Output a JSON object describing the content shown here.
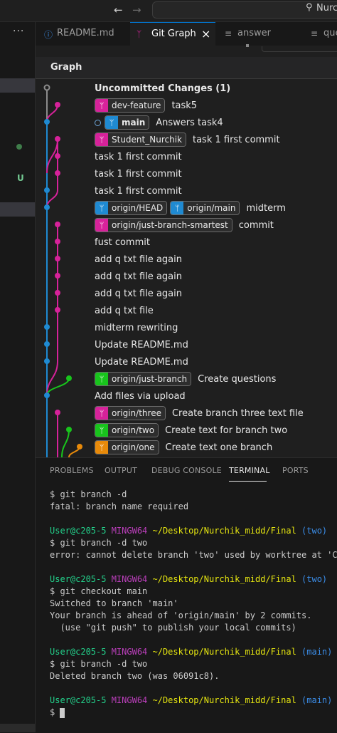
{
  "titlebar": {
    "back_icon": "arrow-left-icon",
    "forward_icon": "arrow-right-icon",
    "search_text": "Nurchik",
    "search_icon": "search-icon"
  },
  "sidebar": {
    "more_icon": "ellipsis-icon",
    "u_badge": "U"
  },
  "tabs": [
    {
      "label": "README.md",
      "icon": "info-icon",
      "active": false
    },
    {
      "label": "Git Graph",
      "icon": "git-graph-icon",
      "active": true,
      "close": "×"
    },
    {
      "label": "answer",
      "icon": "lines-icon",
      "active": false
    },
    {
      "label": "que",
      "icon": "lines-icon",
      "active": false
    }
  ],
  "graph": {
    "header": "Graph",
    "colors": {
      "blue": "#1f8ad2",
      "pink": "#d6229a",
      "green": "#18c41c",
      "orange": "#e88a0a",
      "grey": "#8c8c8c"
    },
    "commits": [
      {
        "refs": [],
        "message": "Uncommitted Changes (1)",
        "bold": true
      },
      {
        "refs": [
          {
            "name": "dev-feature",
            "color": "#d6229a"
          }
        ],
        "message": "task5"
      },
      {
        "head": true,
        "refs": [
          {
            "name": "main",
            "color": "#1f8ad2",
            "head": true
          }
        ],
        "message": "Answers task4"
      },
      {
        "refs": [
          {
            "name": "Student_Nurchik",
            "color": "#d6229a"
          }
        ],
        "message": "task 1 first commit"
      },
      {
        "refs": [],
        "message": "task 1 first commit"
      },
      {
        "refs": [],
        "message": "task 1 first commit"
      },
      {
        "refs": [],
        "message": "task 1 first commit"
      },
      {
        "refs": [
          {
            "name": "origin/HEAD",
            "color": "#1f8ad2"
          },
          {
            "name": "origin/main",
            "color": "#1f8ad2"
          }
        ],
        "message": "midterm"
      },
      {
        "refs": [
          {
            "name": "origin/just-branch-smartest",
            "color": "#d6229a"
          }
        ],
        "message": "commit"
      },
      {
        "refs": [],
        "message": "fust commit"
      },
      {
        "refs": [],
        "message": "add q txt file again"
      },
      {
        "refs": [],
        "message": "add q txt file again"
      },
      {
        "refs": [],
        "message": "add q txt file again"
      },
      {
        "refs": [],
        "message": "add q txt file"
      },
      {
        "refs": [],
        "message": "midterm rewriting"
      },
      {
        "refs": [],
        "message": "Update README.md"
      },
      {
        "refs": [],
        "message": "Update README.md"
      },
      {
        "refs": [
          {
            "name": "origin/just-branch",
            "color": "#18c41c"
          }
        ],
        "message": "Create questions"
      },
      {
        "refs": [],
        "message": "Add files via upload"
      },
      {
        "refs": [
          {
            "name": "origin/three",
            "color": "#d6229a"
          }
        ],
        "message": "Create branch three text file"
      },
      {
        "refs": [
          {
            "name": "origin/two",
            "color": "#18c41c"
          }
        ],
        "message": "Create text for branch two"
      },
      {
        "refs": [
          {
            "name": "origin/one",
            "color": "#e88a0a"
          }
        ],
        "message": "Create text one branch"
      }
    ]
  },
  "panel": {
    "tabs": [
      "PROBLEMS",
      "OUTPUT",
      "DEBUG CONSOLE",
      "TERMINAL",
      "PORTS"
    ],
    "active_tab": "TERMINAL",
    "terminal": {
      "lines": [
        [
          {
            "t": "$ git branch -d",
            "c": ""
          }
        ],
        [
          {
            "t": "fatal: branch name required",
            "c": ""
          }
        ],
        [],
        [
          {
            "t": "User@c205-5 ",
            "c": "pu"
          },
          {
            "t": "MINGW64 ",
            "c": "pm"
          },
          {
            "t": "~/Desktop/Nurchik_midd/Final",
            "c": "pp"
          },
          {
            "t": " (two)",
            "c": "pb"
          }
        ],
        [
          {
            "t": "$ git branch -d two",
            "c": ""
          }
        ],
        [
          {
            "t": "error: cannot delete branch 'two' used by worktree at 'C:/",
            "c": ""
          }
        ],
        [],
        [
          {
            "t": "User@c205-5 ",
            "c": "pu"
          },
          {
            "t": "MINGW64 ",
            "c": "pm"
          },
          {
            "t": "~/Desktop/Nurchik_midd/Final",
            "c": "pp"
          },
          {
            "t": " (two)",
            "c": "pb"
          }
        ],
        [
          {
            "t": "$ git checkout main",
            "c": ""
          }
        ],
        [
          {
            "t": "Switched to branch 'main'",
            "c": ""
          }
        ],
        [
          {
            "t": "Your branch is ahead of 'origin/main' by 2 commits.",
            "c": ""
          }
        ],
        [
          {
            "t": "  (use \"git push\" to publish your local commits)",
            "c": ""
          }
        ],
        [],
        [
          {
            "t": "User@c205-5 ",
            "c": "pu"
          },
          {
            "t": "MINGW64 ",
            "c": "pm"
          },
          {
            "t": "~/Desktop/Nurchik_midd/Final",
            "c": "pp"
          },
          {
            "t": " (main)",
            "c": "pb"
          }
        ],
        [
          {
            "t": "$ git branch -d two",
            "c": ""
          }
        ],
        [
          {
            "t": "Deleted branch two (was 06091c8).",
            "c": ""
          }
        ],
        [],
        [
          {
            "t": "User@c205-5 ",
            "c": "pu"
          },
          {
            "t": "MINGW64 ",
            "c": "pm"
          },
          {
            "t": "~/Desktop/Nurchik_midd/Final",
            "c": "pp"
          },
          {
            "t": " (main)",
            "c": "pb"
          }
        ],
        [
          {
            "t": "$ ",
            "c": ""
          }
        ]
      ]
    }
  }
}
